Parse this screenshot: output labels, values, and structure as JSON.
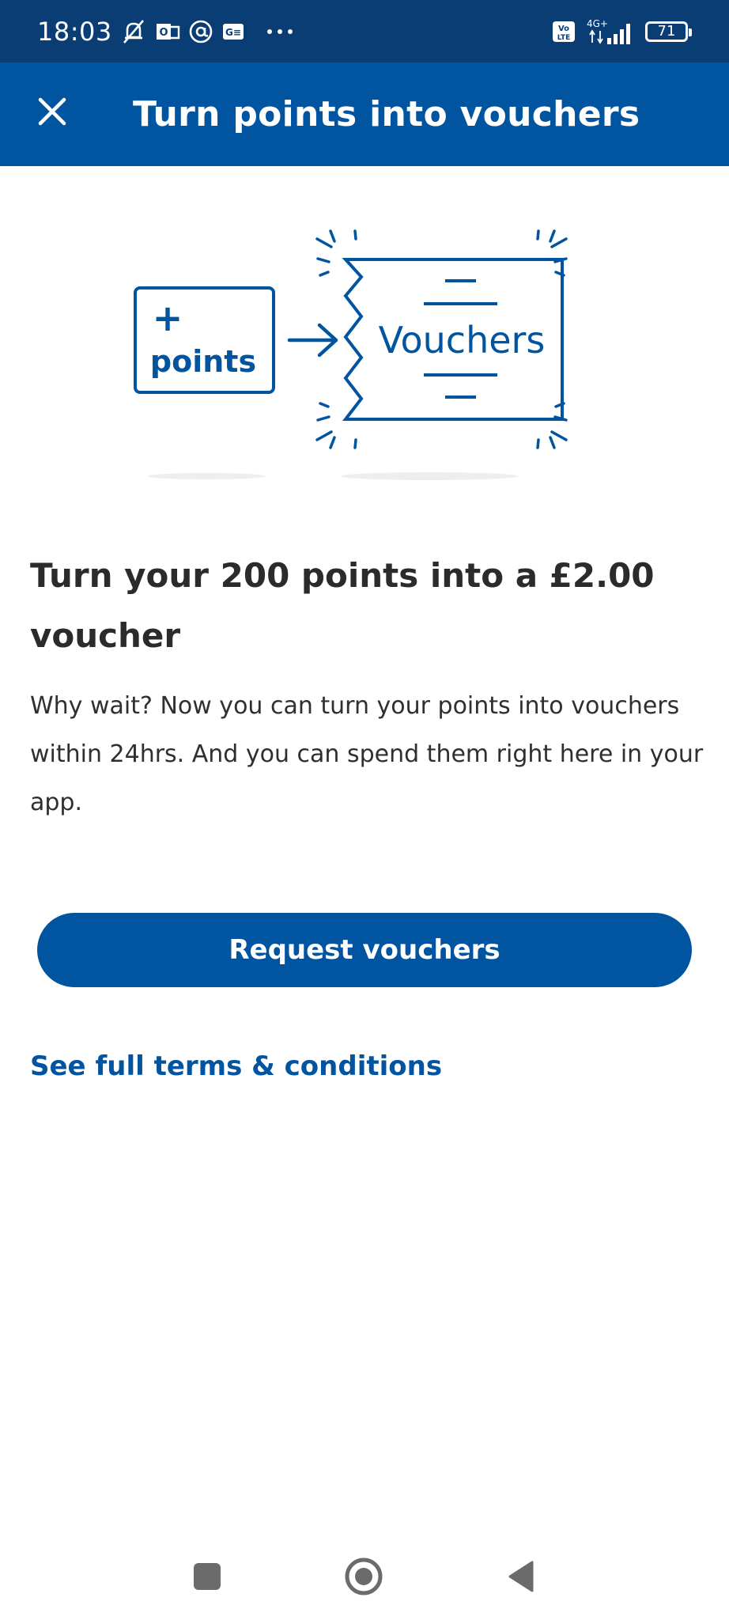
{
  "status_bar": {
    "time": "18:03",
    "battery": "71",
    "network": "4G+",
    "volte": "Vo LTE"
  },
  "header": {
    "title": "Turn points into vouchers"
  },
  "illustration": {
    "points_plus": "+",
    "points_label": "points",
    "vouchers_label": "Vouchers"
  },
  "content": {
    "headline": "Turn your 200 points into a £2.00 voucher",
    "body": "Why wait? Now you can turn your points into vouchers within 24hrs. And you can spend them right here in your app."
  },
  "actions": {
    "request_button": "Request vouchers",
    "terms_link": "See full terms & conditions"
  },
  "colors": {
    "brand_blue": "#0054a0",
    "status_bar": "#0b3d75",
    "text_dark": "#2b2b2b"
  }
}
